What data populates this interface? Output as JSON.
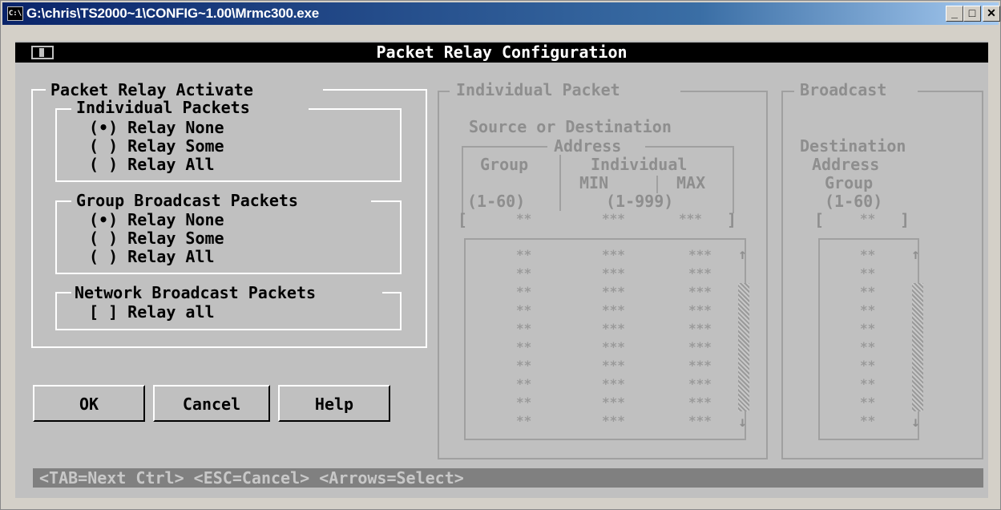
{
  "window": {
    "title": "G:\\chris\\TS2000~1\\CONFIG~1.00\\Mrmc300.exe",
    "icon_text": "C:\\",
    "minimize": "_",
    "maximize": "□",
    "close": "✕"
  },
  "dialog": {
    "title": "Packet Relay Configuration"
  },
  "activate": {
    "title": "Packet Relay Activate",
    "individual": {
      "title": "Individual Packets",
      "options": [
        "(•) Relay None",
        "( ) Relay Some",
        "( ) Relay All"
      ]
    },
    "group": {
      "title": "Group Broadcast Packets",
      "options": [
        "(•) Relay None",
        "( ) Relay Some",
        "( ) Relay All"
      ]
    },
    "network": {
      "title": "Network Broadcast Packets",
      "option": "[ ] Relay all"
    }
  },
  "buttons": {
    "ok": "OK",
    "cancel": "Cancel",
    "help": "Help"
  },
  "individual_packet": {
    "title": "Individual Packet",
    "heading1": "Source or Destination",
    "heading2": "Address",
    "col_group": "Group",
    "col_individual": "Individual",
    "col_min": "MIN",
    "col_max": "MAX",
    "range_group": "(1-60)",
    "range_individual": "(1-999)",
    "entry": {
      "group": "**",
      "min": "***",
      "max": "***"
    },
    "rows": [
      [
        "**",
        "***",
        "***"
      ],
      [
        "**",
        "***",
        "***"
      ],
      [
        "**",
        "***",
        "***"
      ],
      [
        "**",
        "***",
        "***"
      ],
      [
        "**",
        "***",
        "***"
      ],
      [
        "**",
        "***",
        "***"
      ],
      [
        "**",
        "***",
        "***"
      ],
      [
        "**",
        "***",
        "***"
      ],
      [
        "**",
        "***",
        "***"
      ],
      [
        "**",
        "***",
        "***"
      ]
    ]
  },
  "broadcast": {
    "title": "Broadcast",
    "label1": "Destination",
    "label2": "Address",
    "label3": "Group",
    "range": "(1-60)",
    "entry": "**",
    "rows": [
      "**",
      "**",
      "**",
      "**",
      "**",
      "**",
      "**",
      "**",
      "**",
      "**"
    ]
  },
  "status": "<TAB=Next Ctrl> <ESC=Cancel> <Arrows=Select>"
}
